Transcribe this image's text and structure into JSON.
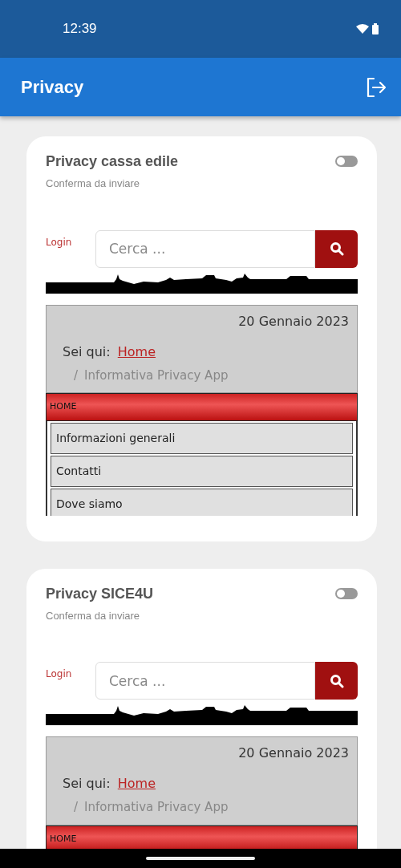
{
  "status_bar": {
    "time": "12:39"
  },
  "app_bar": {
    "title": "Privacy"
  },
  "cards": [
    {
      "title": "Privacy cassa edile",
      "subtitle": "Conferma da inviare",
      "toggle": {
        "on": false
      },
      "page": {
        "login": "Login",
        "search": {
          "placeholder": "Cerca ..."
        },
        "date": "20 Gennaio 2023",
        "breadcrumb": {
          "label": "Sei qui:",
          "home": "Home",
          "separator": "/",
          "current": "Informativa Privacy App"
        },
        "menu": [
          {
            "kind": "header",
            "label": "HOME"
          },
          {
            "kind": "item",
            "label": "Informazioni generali"
          },
          {
            "kind": "item",
            "label": "Contatti"
          },
          {
            "kind": "item",
            "label": "Dove siamo"
          }
        ]
      }
    },
    {
      "title": "Privacy SICE4U",
      "subtitle": "Conferma da inviare",
      "toggle": {
        "on": false
      },
      "page": {
        "login": "Login",
        "search": {
          "placeholder": "Cerca ..."
        },
        "date": "20 Gennaio 2023",
        "breadcrumb": {
          "label": "Sei qui:",
          "home": "Home",
          "separator": "/",
          "current": "Informativa Privacy App"
        },
        "menu": [
          {
            "kind": "header",
            "label": "HOME"
          }
        ]
      }
    }
  ]
}
